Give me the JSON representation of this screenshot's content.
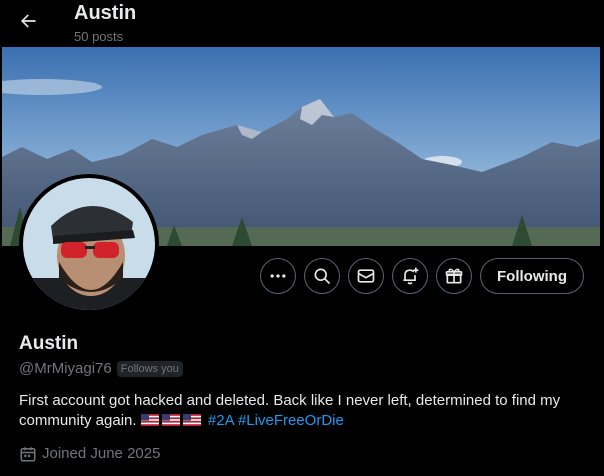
{
  "header": {
    "name": "Austin",
    "posts": "50 posts"
  },
  "actions": {
    "more_icon": "more-icon",
    "search_icon": "search-icon",
    "message_icon": "message-icon",
    "notify_icon": "notification-plus-icon",
    "gift_icon": "gift-icon",
    "following_label": "Following"
  },
  "profile": {
    "name": "Austin",
    "handle": "@MrMiyagi76",
    "follows_you": "Follows you",
    "bio_text": "First account got hacked and deleted. Back like I never left, determined to find my community again.",
    "hashtags": [
      "#2A",
      "#LiveFreeOrDie"
    ],
    "joined": "Joined June 2025"
  },
  "colors": {
    "background": "#000000",
    "text": "#e7e9ea",
    "muted": "#71767b",
    "link": "#1d9bf0",
    "border": "#536471"
  }
}
